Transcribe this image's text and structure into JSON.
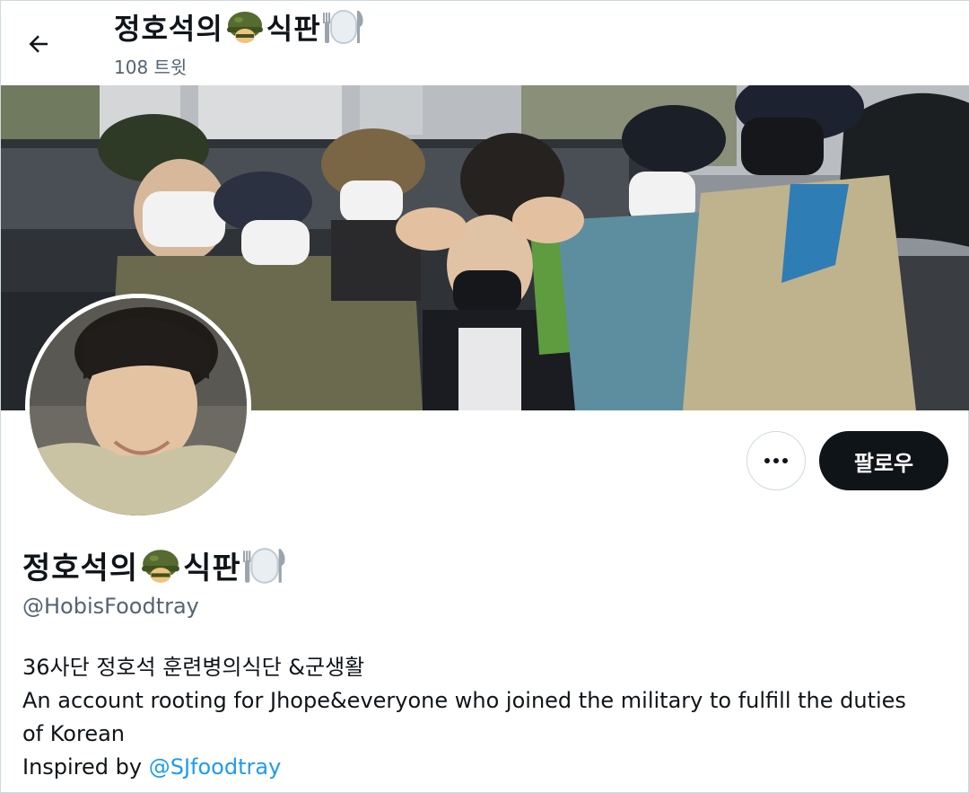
{
  "header": {
    "title_part1": "정호석의",
    "title_part2": "식판",
    "tweet_count": "108 트윗"
  },
  "actions": {
    "follow_label": "팔로우",
    "more_label": "···"
  },
  "profile": {
    "name_part1": "정호석의",
    "name_part2": "식판",
    "handle": "@HobisFoodtray",
    "bio_line1": "36사단 정호석 훈련병의식단 &군생활",
    "bio_line2": "An account rooting for Jhope&everyone who joined the military to fulfill the duties",
    "bio_line3": "of Korean",
    "bio_inspired_prefix": "Inspired by ",
    "bio_inspired_mention": "@SJfoodtray"
  },
  "icons": {
    "back": "back-arrow-icon",
    "helmet": "military-helmet-icon",
    "fork_knife": "fork-knife-plate-icon",
    "more": "more-horizontal-icon"
  },
  "colors": {
    "text_primary": "#0f1419",
    "text_secondary": "#536471",
    "link": "#1d9bf0",
    "follow_button_bg": "#0f1419",
    "helmet_green": "#4e6b2e"
  }
}
